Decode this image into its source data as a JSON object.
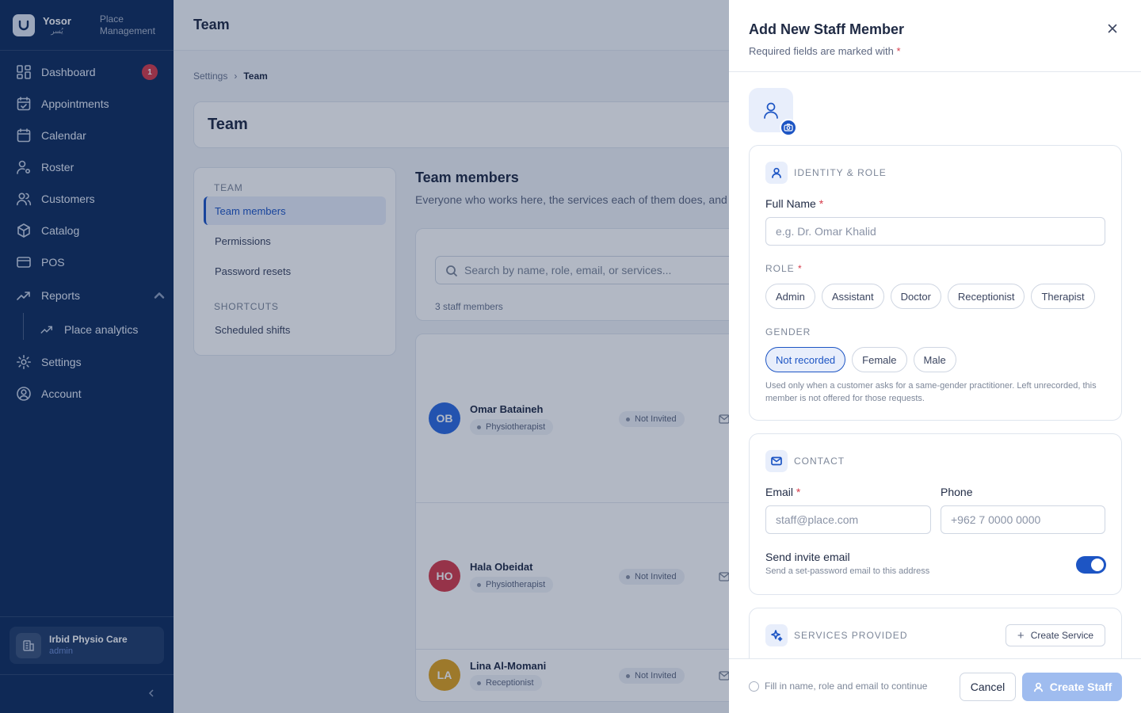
{
  "brand": {
    "name": "Yosor",
    "sub": "يُسر",
    "desc_line1": "Place",
    "desc_line2": "Management"
  },
  "nav": {
    "dashboard": "Dashboard",
    "dashboard_badge": "1",
    "appointments": "Appointments",
    "calendar": "Calendar",
    "roster": "Roster",
    "customers": "Customers",
    "catalog": "Catalog",
    "pos": "POS",
    "reports": "Reports",
    "place_analytics": "Place analytics",
    "settings": "Settings",
    "account": "Account"
  },
  "place": {
    "name": "Irbid Physio Care",
    "role": "admin"
  },
  "topbar": {
    "title": "Team"
  },
  "breadcrumb": {
    "parent": "Settings",
    "current": "Team"
  },
  "page": {
    "title": "Team"
  },
  "subnav": {
    "team_head": "TEAM",
    "team_members": "Team members",
    "permissions": "Permissions",
    "password_resets": "Password resets",
    "shortcuts_head": "SHORTCUTS",
    "scheduled_shifts": "Scheduled shifts"
  },
  "team": {
    "title": "Team members",
    "desc": "Everyone who works here, the services each of them does, and",
    "search_placeholder": "Search by name, role, email, or services...",
    "count": "3 staff members",
    "members": [
      {
        "initials": "OB",
        "name": "Omar Bataineh",
        "role": "Physiotherapist",
        "status": "Not Invited",
        "color": "#2d6be0"
      },
      {
        "initials": "HO",
        "name": "Hala Obeidat",
        "role": "Physiotherapist",
        "status": "Not Invited",
        "color": "#d63b4a"
      },
      {
        "initials": "LA",
        "name": "Lina Al-Momani",
        "role": "Receptionist",
        "status": "Not Invited",
        "color": "#e0a21e"
      }
    ]
  },
  "drawer": {
    "title": "Add New Staff Member",
    "subtitle": "Required fields are marked with",
    "required_mark": "*",
    "identity": {
      "heading": "IDENTITY & ROLE",
      "full_name_label": "Full Name",
      "full_name_placeholder": "e.g. Dr. Omar Khalid",
      "role_label": "ROLE",
      "roles": [
        "Admin",
        "Assistant",
        "Doctor",
        "Receptionist",
        "Therapist"
      ],
      "gender_label": "GENDER",
      "genders": [
        "Not recorded",
        "Female",
        "Male"
      ],
      "selected_gender": "Not recorded",
      "gender_hint": "Used only when a customer asks for a same-gender practitioner. Left unrecorded, this member is not offered for those requests."
    },
    "contact": {
      "heading": "CONTACT",
      "email_label": "Email",
      "email_placeholder": "staff@place.com",
      "phone_label": "Phone",
      "phone_placeholder": "+962 7 0000 0000",
      "invite_title": "Send invite email",
      "invite_desc": "Send a set-password email to this address",
      "invite_enabled": true
    },
    "services": {
      "heading": "SERVICES PROVIDED",
      "create_label": "Create Service"
    },
    "footer": {
      "hint": "Fill in name, role and email to continue",
      "cancel": "Cancel",
      "create": "Create Staff"
    }
  },
  "colors": {
    "sidebar": "#0f2d5e",
    "accent": "#1d55c4",
    "danger": "#d63b4a"
  }
}
